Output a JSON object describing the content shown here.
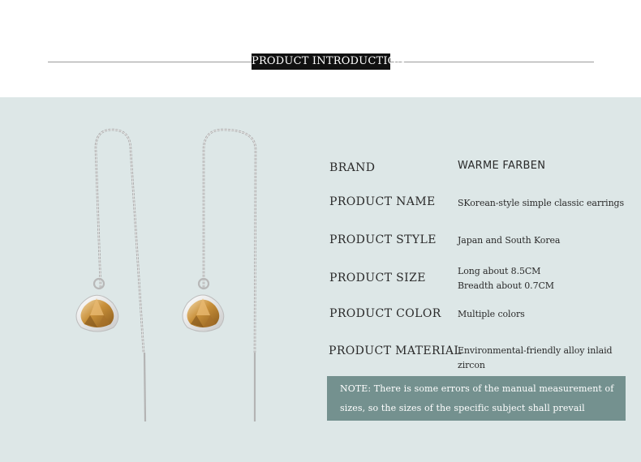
{
  "header": {
    "title": "PRODUCT INTRODUCTION"
  },
  "specs": [
    {
      "label": "BRAND",
      "value": "WARME FARBEN"
    },
    {
      "label": "PRODUCT NAME",
      "value": "SKorean-style simple classic earrings"
    },
    {
      "label": "PRODUCT STYLE",
      "value": "Japan and South Korea"
    },
    {
      "label": "PRODUCT SIZE",
      "value_line1": "Long about 8.5CM",
      "value_line2": "Breadth about 0.7CM"
    },
    {
      "label": "PRODUCT COLOR",
      "value": "Multiple colors"
    },
    {
      "label": "PRODUCT MATERIAL",
      "value_line1": "Environmental-friendly alloy inlaid",
      "value_line2": "zircon"
    }
  ],
  "note": {
    "line1": "NOTE: There is some errors of the manual measurement of",
    "line2": "sizes, so the sizes of the specific subject shall prevail"
  },
  "colors": {
    "panel_bg": "#dde7e7",
    "note_bg": "#74918f",
    "header_label_bg": "#111111",
    "gem": "#c8903a"
  }
}
